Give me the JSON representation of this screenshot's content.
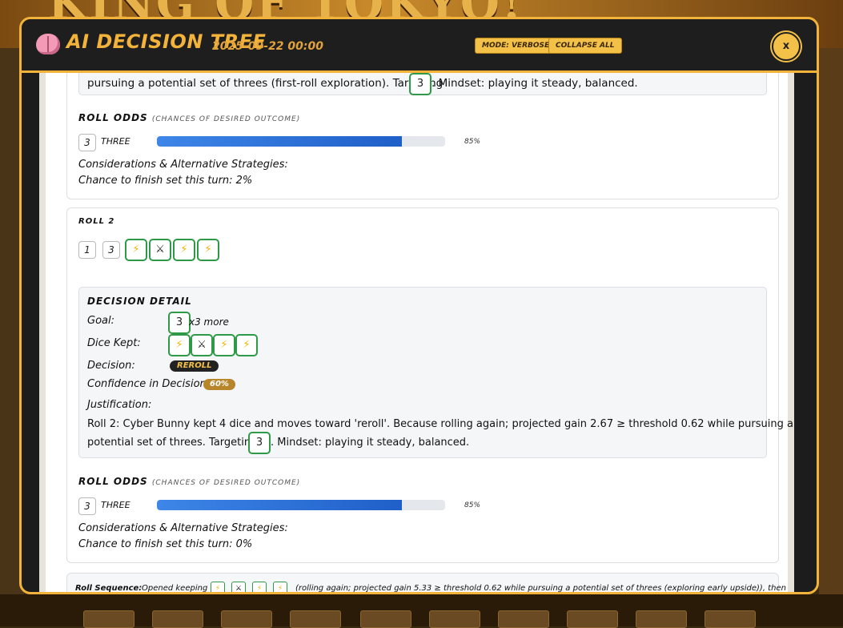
{
  "backdrop": {
    "title": "KING OF TOKYO!"
  },
  "modal": {
    "title": "AI DECISION TREE",
    "date": "2025-09-22 00:00",
    "mode_button": "MODE: VERBOSE",
    "collapse_button": "COLLAPSE ALL",
    "close_label": "x"
  },
  "roll1": {
    "justification_tail_pre": "pursuing a potential set of threes (first-roll exploration). Targeting",
    "target_die": "3",
    "justification_tail_post": ". Mindset: playing it steady, balanced.",
    "odds_title": "ROLL ODDS",
    "odds_subtitle": "(CHANCES OF DESIRED OUTCOME)",
    "odds_die": "3",
    "odds_label": "THREE",
    "odds_percent": 85,
    "odds_percent_text": "85%",
    "considerations": "Considerations & Alternative Strategies:",
    "finish_chance": "Chance to finish set this turn: 2%"
  },
  "roll2": {
    "title": "ROLL 2",
    "dice": [
      "1",
      "3",
      "⚡",
      "⚔",
      "⚡",
      "⚡"
    ],
    "detail": {
      "title": "DECISION DETAIL",
      "goal_label": "Goal:",
      "goal_die": "3",
      "goal_suffix": "x3 more",
      "kept_label": "Dice Kept:",
      "kept": [
        "⚡",
        "⚔",
        "⚡",
        "⚡"
      ],
      "decision_label": "Decision:",
      "decision": "REROLL",
      "confidence_label": "Confidence in Decision:",
      "confidence": "60%",
      "justification_label": "Justification:",
      "justification_line1": "Roll 2: Cyber Bunny kept 4 dice and moves toward 'reroll'. Because rolling again; projected gain 2.67 ≥ threshold 0.62 while pursuing a",
      "justification_line2_pre": "potential set of threes. Targeting",
      "target_die": "3",
      "justification_line2_post": ". Mindset: playing it steady, balanced."
    },
    "odds_title": "ROLL ODDS",
    "odds_subtitle": "(CHANCES OF DESIRED OUTCOME)",
    "odds_die": "3",
    "odds_label": "THREE",
    "odds_percent": 85,
    "odds_percent_text": "85%",
    "considerations": "Considerations & Alternative Strategies:",
    "finish_chance": "Chance to finish set this turn: 0%"
  },
  "sequence": {
    "label": "Roll Sequence:",
    "text_pre": "Opened keeping",
    "kept": [
      "⚡",
      "⚔",
      "⚡",
      "⚡"
    ],
    "text_post": "(rolling again; projected gain 5.33 ≥ threshold 0.62 while pursuing a potential set of threes (exploring early upside)), then"
  }
}
